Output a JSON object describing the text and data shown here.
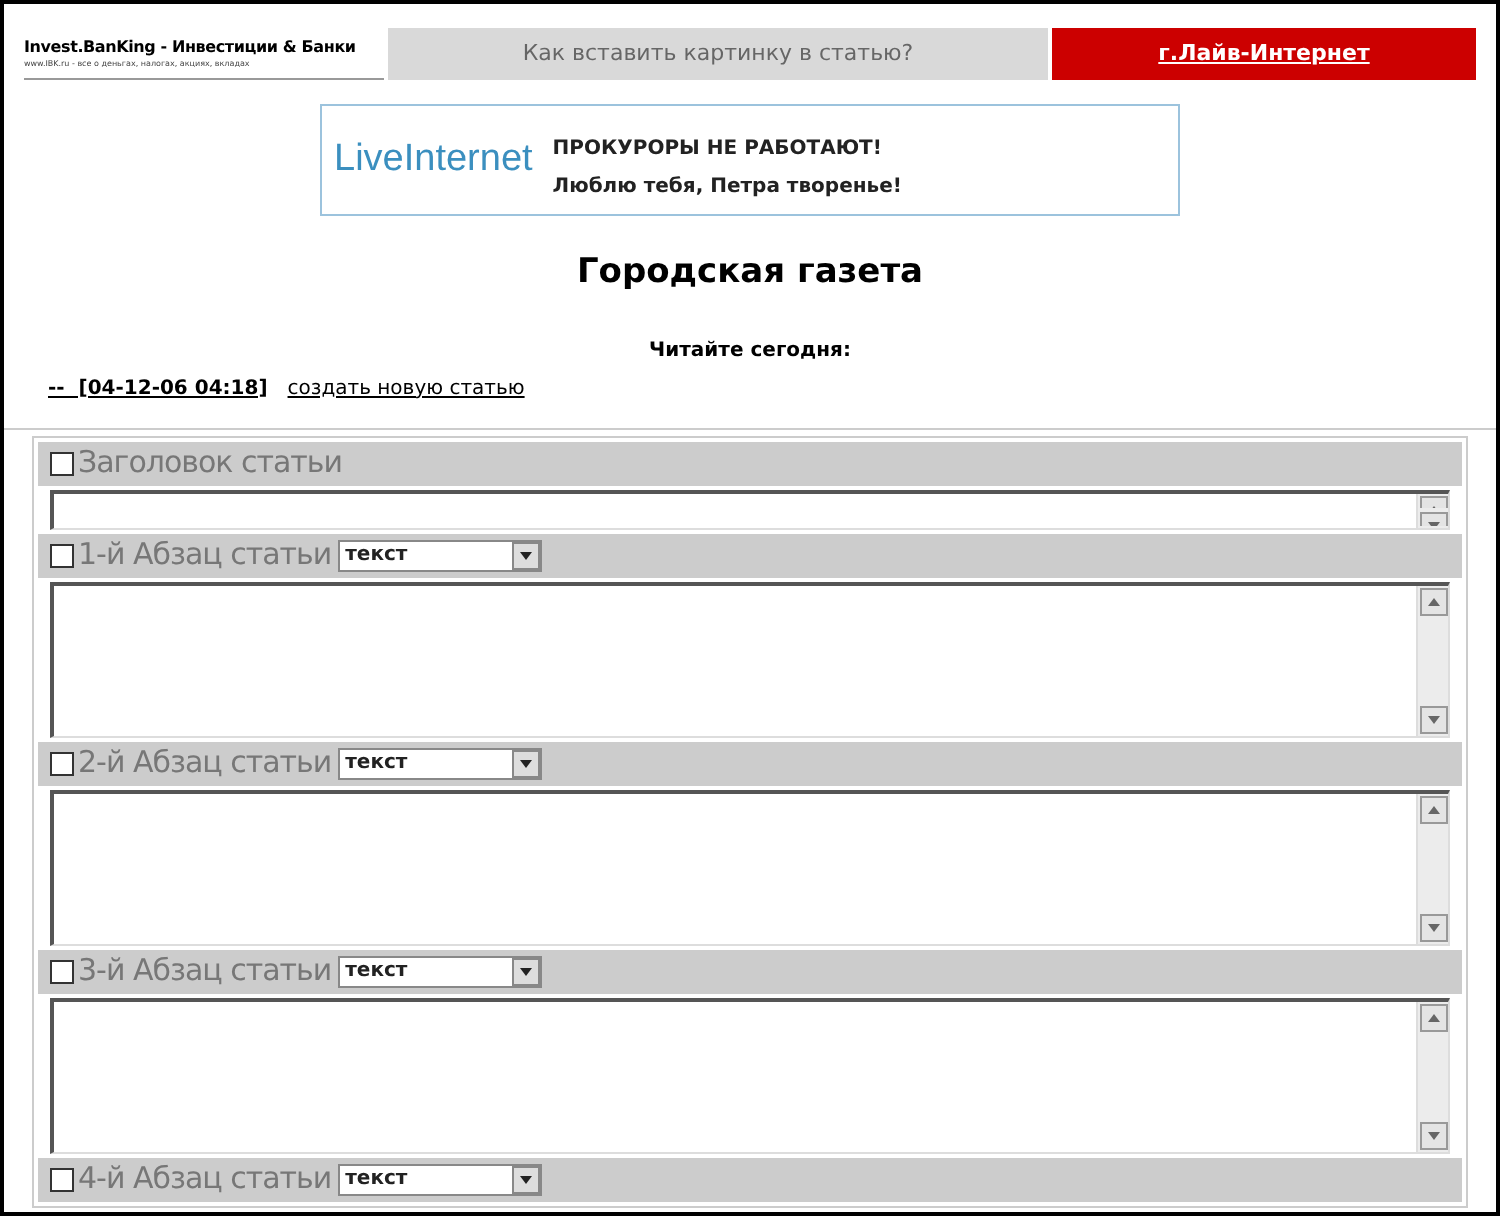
{
  "header": {
    "logo": "Invest.BanKing - Инвестиции & Банки",
    "logo_tagline": "www.IBK.ru - все о деньгах, налогах, акциях, вкладах",
    "help_link": "Как вставить картинку в статью?",
    "community_link": "г.Лайв-Интернет"
  },
  "banner": {
    "brand": "LiveInternet",
    "headline": "ПРОКУРОРЫ НЕ РАБОТАЮТ!",
    "subline": "Люблю тебя, Петра творенье!"
  },
  "page_title": "Городская газета",
  "read_today": "Читайте сегодня:",
  "post_line": {
    "date": "--  [04-12-06 04:18]",
    "create_link": "создать новую статью"
  },
  "form_fields": [
    {
      "kind": "title",
      "label": "Заголовок статьи",
      "checked": false
    },
    {
      "kind": "paragraph",
      "label": "1-й Абзац статьи",
      "checked": false,
      "type_select": "текст"
    },
    {
      "kind": "paragraph",
      "label": "2-й Абзац статьи",
      "checked": false,
      "type_select": "текст"
    },
    {
      "kind": "paragraph",
      "label": "3-й Абзац статьи",
      "checked": false,
      "type_select": "текст"
    },
    {
      "kind": "paragraph_header",
      "label": "4-й Абзац статьи",
      "checked": false,
      "type_select": "текст"
    }
  ]
}
